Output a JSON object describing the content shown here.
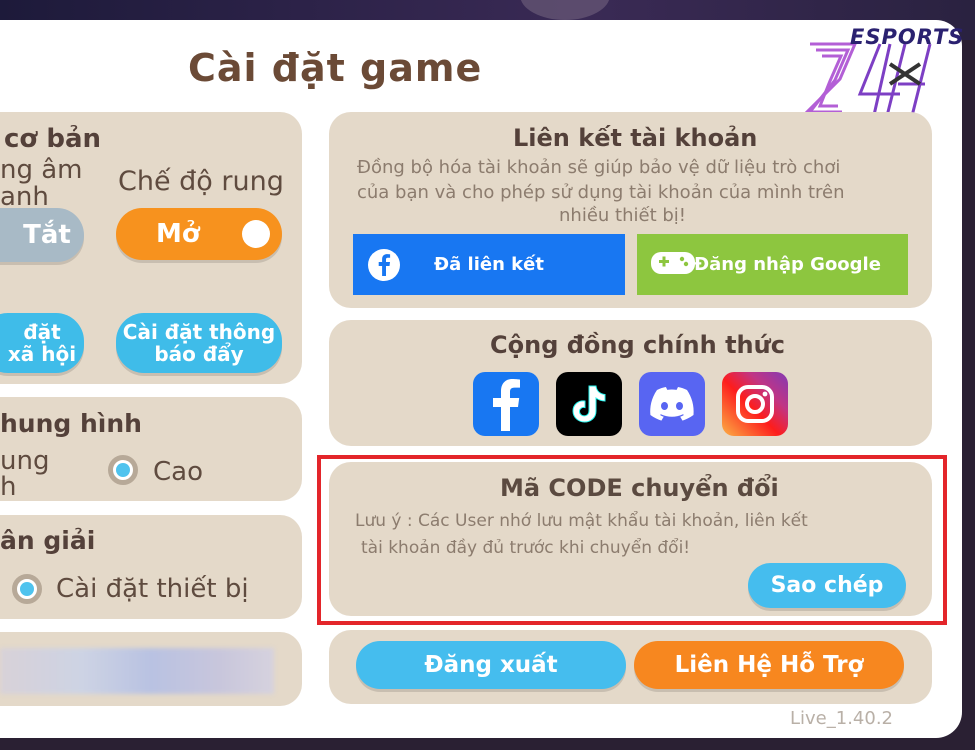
{
  "title": "Cài đặt game",
  "logo": {
    "brand": "ESPORTS"
  },
  "left": {
    "basic": {
      "header": "cơ bản",
      "sound_label_line1": "ng âm",
      "sound_label_line2": "anh",
      "sound_value": "Tắt",
      "vibration_label": "Chế độ rung",
      "vibration_value": "Mở",
      "social_btn_line1": "đặt",
      "social_btn_line2": "xã hội",
      "push_btn_line1": "Cài đặt thông",
      "push_btn_line2": "báo đẩy"
    },
    "graphics": {
      "header": "hung hình",
      "option_left_line1": "ung",
      "option_left_line2": "h",
      "option_high": "Cao"
    },
    "resolution": {
      "header": "ân giải",
      "option_device": "Cài đặt thiết bị"
    }
  },
  "account": {
    "header": "Liên kết tài khoản",
    "desc_line1": "Đồng bộ hóa tài khoản sẽ giúp bảo vệ dữ liệu trò chơi",
    "desc_line2": "của bạn và cho phép sử dụng tài khoản của mình trên",
    "desc_line3": "nhiều thiết bị!",
    "facebook_btn": "Đã liên kết",
    "google_btn": "Đăng nhập Google"
  },
  "community": {
    "header": "Cộng đồng chính thức"
  },
  "code": {
    "header": "Mã CODE chuyển đổi",
    "note_line1": "Lưu ý  : Các User nhớ  lưu mật khẩu tài khoản, liên kết",
    "note_line2": "tài khoản đầy đủ trước khi chuyển đổi!",
    "copy_btn": "Sao chép"
  },
  "footer": {
    "logout_btn": "Đăng xuất",
    "support_btn": "Liên Hệ Hỗ Trợ",
    "version": "Live_1.40.2"
  }
}
